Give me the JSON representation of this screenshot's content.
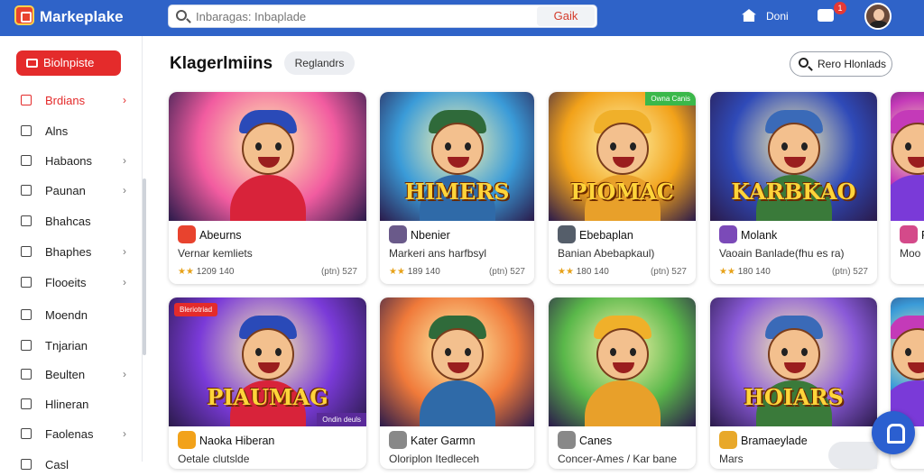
{
  "app": {
    "brand": "Markeplake"
  },
  "search": {
    "placeholder": "Inbaragas: Inbaplade",
    "button": "Gaik"
  },
  "header": {
    "home_label": "Doni",
    "notifications": "1"
  },
  "sidebar": {
    "primary_button": "Biolnpiste",
    "items": [
      {
        "label": "Brdians",
        "chevron": true,
        "active": true
      },
      {
        "label": "Alns",
        "chevron": false,
        "active": false
      },
      {
        "label": "Habaons",
        "chevron": true,
        "active": false
      },
      {
        "label": "Paunan",
        "chevron": true,
        "active": false
      },
      {
        "label": "Bhahcas",
        "chevron": false,
        "active": false
      },
      {
        "label": "Bhaphes",
        "chevron": true,
        "active": false
      },
      {
        "label": "Flooeits",
        "chevron": true,
        "active": false
      },
      {
        "label": "Moendn",
        "chevron": false,
        "active": false
      },
      {
        "label": "Tnjarian",
        "chevron": false,
        "active": false
      },
      {
        "label": "Beulten",
        "chevron": true,
        "active": false
      },
      {
        "label": "Hlineran",
        "chevron": false,
        "active": false
      },
      {
        "label": "Faolenas",
        "chevron": true,
        "active": false
      },
      {
        "label": "Casl",
        "chevron": false,
        "active": false
      }
    ]
  },
  "main": {
    "title": "Klagerlmiins",
    "chip": "Reglandrs",
    "sort_label": "Rero Hlonlads",
    "cards_row1": [
      {
        "art_title": "",
        "icon_color": "#e8432e",
        "name": "Abeurns",
        "sub": "Vernar kemliets",
        "rating": "1209 140",
        "price": "(ptn) 527",
        "theme": "#f25ca0"
      },
      {
        "art_title": "HIMERS",
        "icon_color": "#6a5a8a",
        "name": "Nbenier",
        "sub": "Markeri ans harfbsyl",
        "rating": "189 140",
        "price": "(ptn) 527",
        "theme": "#3a9bd8"
      },
      {
        "art_title": "PIOMAC",
        "icon_color": "#555e6a",
        "name": "Ebebaplan",
        "sub": "Banian Abebapkaul)",
        "rating": "180 140",
        "price": "(ptn) 527",
        "theme": "#f2a21a",
        "ribbon": "Owna Canis"
      },
      {
        "art_title": "KARBKAO",
        "icon_color": "#7b4ab8",
        "name": "Molank",
        "sub": "Vaoain Banlade(fhu es ra)",
        "rating": "180 140",
        "price": "(ptn) 527",
        "theme": "#2f4ab8"
      },
      {
        "art_title": "",
        "icon_color": "#d44a8a",
        "name": "Reenl",
        "sub": "Moo",
        "rating": "",
        "price": "",
        "theme": "#c43ab8"
      }
    ],
    "cards_row2": [
      {
        "art_title": "PIAUMAG",
        "icon_color": "#f2a21a",
        "name": "Naoka Hiberan",
        "sub": "Oetale clutslde",
        "theme": "#7a3ad8",
        "ribbon": "Bleriotriad",
        "ribbon2": "Ondin deuls"
      },
      {
        "art_title": "",
        "icon_color": "#888",
        "name": "Kater Garmn",
        "sub": "Oloriplon Itedleceh",
        "theme": "#f07a3a"
      },
      {
        "art_title": "",
        "icon_color": "#888",
        "name": "Canes",
        "sub": "Concer-Ames / Kar bane",
        "theme": "#5ab84a"
      },
      {
        "art_title": "HOIARS",
        "icon_color": "#e8a82a",
        "name": "Bramaeylade",
        "sub": "Mars",
        "theme": "#8a5ad8"
      },
      {
        "art_title": "",
        "icon_color": "#888",
        "name": "",
        "sub": "",
        "theme": "#3a9bd8"
      }
    ]
  },
  "colors": {
    "topbar": "#2f63c8",
    "accent": "#e42b2b"
  }
}
